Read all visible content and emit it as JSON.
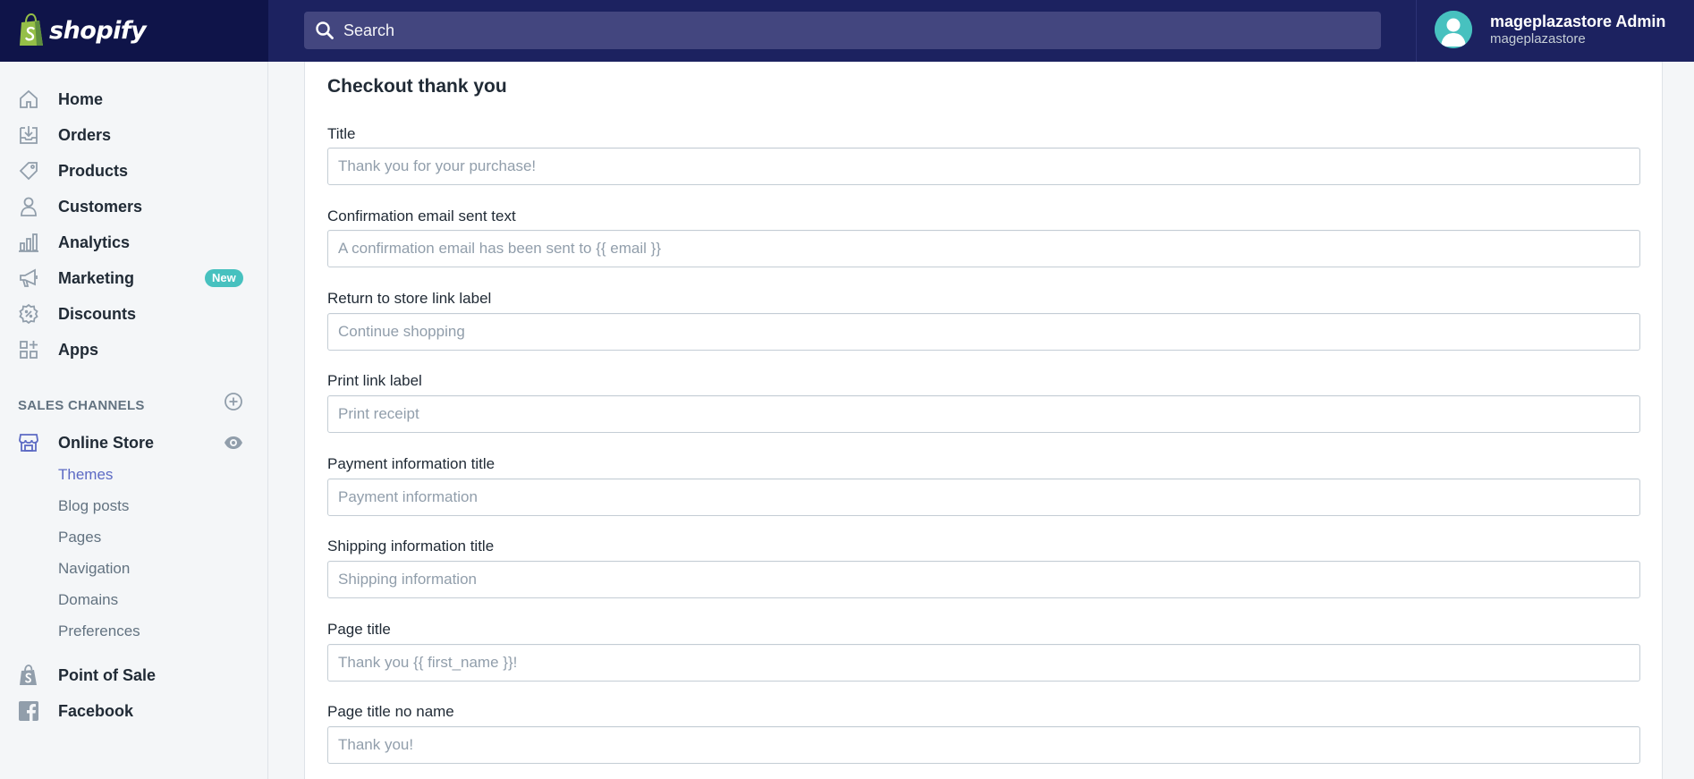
{
  "app": {
    "brand": "shopify",
    "colors": {
      "topbar": "#1c2260",
      "accent": "#5c6ac4",
      "badge": "#47c1bf"
    }
  },
  "search": {
    "placeholder": "Search"
  },
  "user": {
    "name": "mageplazastore Admin",
    "store": "mageplazastore"
  },
  "sidebar": {
    "items": [
      {
        "label": "Home",
        "icon": "home-icon"
      },
      {
        "label": "Orders",
        "icon": "orders-icon"
      },
      {
        "label": "Products",
        "icon": "tag-icon"
      },
      {
        "label": "Customers",
        "icon": "person-icon"
      },
      {
        "label": "Analytics",
        "icon": "bar-chart-icon"
      },
      {
        "label": "Marketing",
        "icon": "megaphone-icon",
        "badge": "New"
      },
      {
        "label": "Discounts",
        "icon": "discount-icon"
      },
      {
        "label": "Apps",
        "icon": "apps-icon"
      }
    ],
    "sales_channels_heading": "SALES CHANNELS",
    "online_store": {
      "label": "Online Store",
      "icon": "store-icon"
    },
    "online_store_sub": [
      "Themes",
      "Blog posts",
      "Pages",
      "Navigation",
      "Domains",
      "Preferences"
    ],
    "active_sub": "Themes",
    "point_of_sale": {
      "label": "Point of Sale",
      "icon": "pos-bag-icon"
    },
    "facebook": {
      "label": "Facebook",
      "icon": "facebook-icon"
    }
  },
  "main": {
    "section_title": "Checkout thank you",
    "fields": [
      {
        "label": "Title",
        "value": "Thank you for your purchase!"
      },
      {
        "label": "Confirmation email sent text",
        "value": "A confirmation email has been sent to {{ email }}"
      },
      {
        "label": "Return to store link label",
        "value": "Continue shopping"
      },
      {
        "label": "Print link label",
        "value": "Print receipt"
      },
      {
        "label": "Payment information title",
        "value": "Payment information"
      },
      {
        "label": "Shipping information title",
        "value": "Shipping information"
      },
      {
        "label": "Page title",
        "value": "Thank you {{ first_name }}!"
      },
      {
        "label": "Page title no name",
        "value": "Thank you!"
      }
    ]
  }
}
